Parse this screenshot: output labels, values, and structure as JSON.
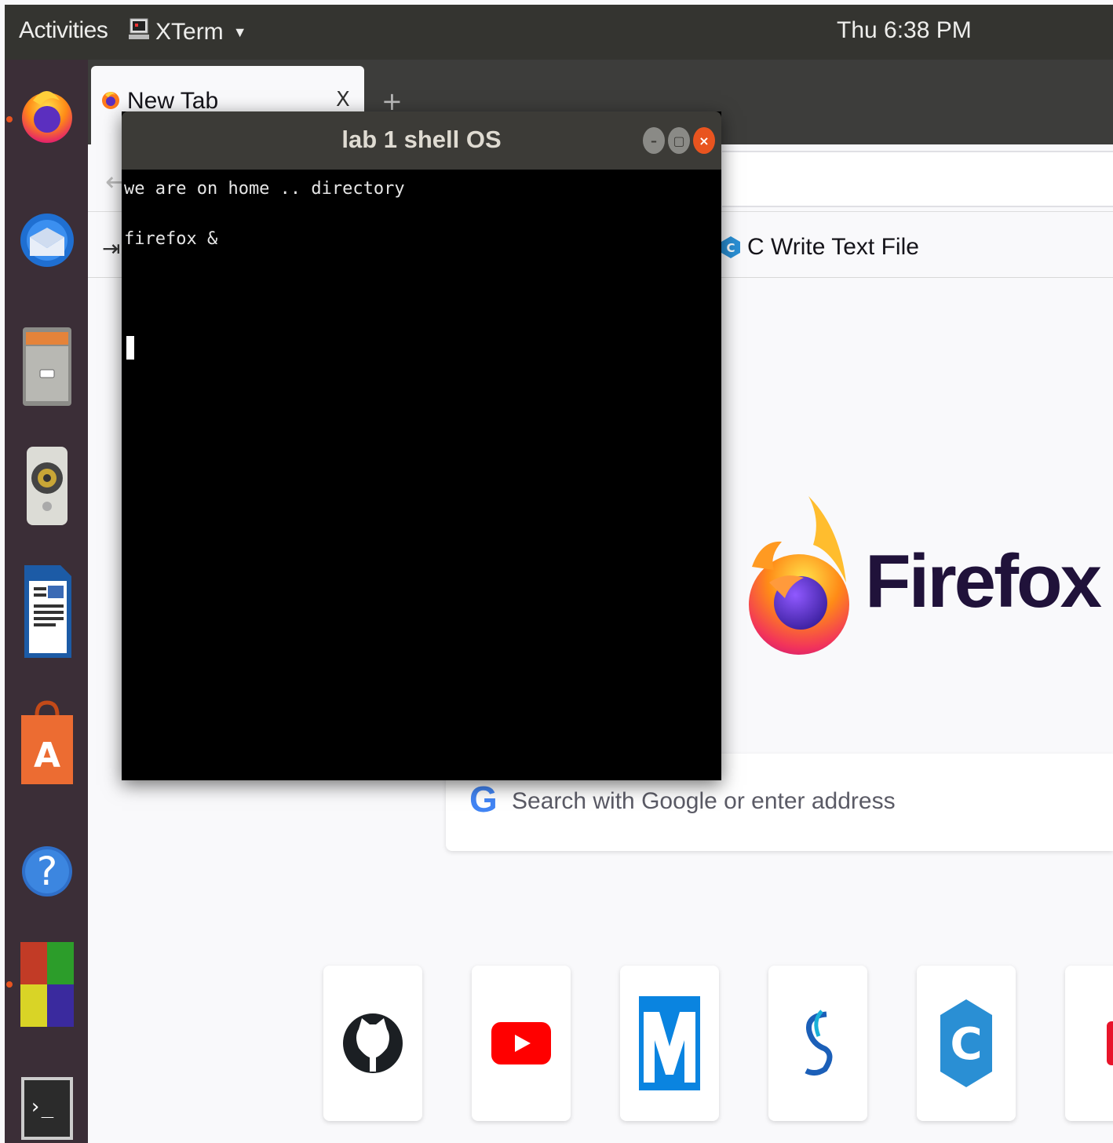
{
  "topbar": {
    "activities_label": "Activities",
    "app_menu_label": "XTerm",
    "clock": "Thu  6:38 PM"
  },
  "dock": {
    "items": [
      {
        "name": "firefox",
        "icon": "firefox-icon",
        "running": true
      },
      {
        "name": "thunderbird",
        "icon": "thunderbird-icon",
        "running": false
      },
      {
        "name": "files",
        "icon": "files-icon",
        "running": false
      },
      {
        "name": "rhythmbox",
        "icon": "speaker-icon",
        "running": false
      },
      {
        "name": "libreoffice-writer",
        "icon": "writer-icon",
        "running": false
      },
      {
        "name": "ubuntu-software",
        "icon": "software-bag-icon",
        "running": false
      },
      {
        "name": "help",
        "icon": "help-icon",
        "running": false
      },
      {
        "name": "app-grid-colored",
        "icon": "colored-blocks-icon",
        "running": true
      },
      {
        "name": "terminal",
        "icon": "terminal-icon",
        "running": false
      }
    ]
  },
  "firefox": {
    "tab_title": "New Tab",
    "tab_close": "X",
    "new_tab": "+",
    "bookmark_label": "C Write Text File",
    "wordmark": "Firefox",
    "search_placeholder": "Search with Google or enter address",
    "google_glyph": "G",
    "tiles": [
      {
        "name": "github",
        "icon": "github-icon",
        "label": "github"
      },
      {
        "name": "youtube",
        "icon": "youtube-icon",
        "label": "youtube"
      },
      {
        "name": "m-site",
        "icon": "m-logo-icon",
        "label": ""
      },
      {
        "name": "s-site",
        "icon": "s-logo-icon",
        "label": ""
      },
      {
        "name": "c-site",
        "icon": "c-logo-icon",
        "label": ""
      },
      {
        "name": "red-site",
        "icon": "red-logo-icon",
        "label": ""
      }
    ]
  },
  "xterm": {
    "title": "lab 1 shell OS",
    "lines": [
      "we are on home .. directory",
      "firefox &"
    ]
  },
  "colors": {
    "topbar": "#343430",
    "dock": "#3b2e37",
    "accent_orange": "#e95420",
    "terminal_bg": "#000000",
    "firefox_wordmark": "#20123a"
  }
}
